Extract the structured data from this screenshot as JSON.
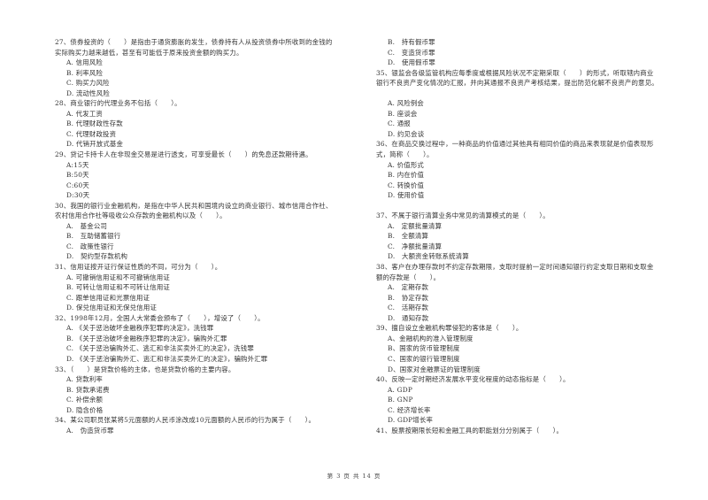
{
  "left_column": [
    {
      "type": "stem",
      "text": "27、债券投资的（　　）是指由于通货膨胀的发生，债券持有人从投资债券中所收到的金钱的"
    },
    {
      "type": "stem",
      "text": "实际购买力越来越低，甚至有可能低于原来投资金额的购买力。"
    },
    {
      "type": "opt",
      "text": "A. 信用风险"
    },
    {
      "type": "opt",
      "text": "B. 利率风险"
    },
    {
      "type": "opt",
      "text": "C. 购买力风险"
    },
    {
      "type": "opt",
      "text": "D. 流动性风险"
    },
    {
      "type": "stem",
      "text": "28、商业银行的代理业务不包括（　　）。"
    },
    {
      "type": "opt",
      "text": "A. 代发工资"
    },
    {
      "type": "opt",
      "text": "B. 代理财政性存款"
    },
    {
      "type": "opt",
      "text": "C. 代理财政投资"
    },
    {
      "type": "opt",
      "text": "D. 代销开放式基金"
    },
    {
      "type": "stem",
      "text": "29、贷记卡持卡人在非现金交易是进行透支，可享受最长（　　）的免息还款期待遇。"
    },
    {
      "type": "opt",
      "text": "A:15天"
    },
    {
      "type": "opt",
      "text": "B:50天"
    },
    {
      "type": "opt",
      "text": "C:60天"
    },
    {
      "type": "opt",
      "text": "D:30天"
    },
    {
      "type": "stem",
      "text": "30、我国的银行业金融机构，是指在中华人民共和国境内设立的商业银行、城市信用合作社、"
    },
    {
      "type": "stem",
      "text": "农村信用合作社等吸收公众存款的金融机构以及（　　）。"
    },
    {
      "type": "opt",
      "text": "A.　基金公司"
    },
    {
      "type": "opt",
      "text": "B.　互助储蓄银行"
    },
    {
      "type": "opt",
      "text": "C.　政策性银行"
    },
    {
      "type": "opt",
      "text": "D.　契约型存款机构"
    },
    {
      "type": "stem",
      "text": "31、信用证按开证行保证性质的不同，可分为（　　）。"
    },
    {
      "type": "opt",
      "text": "A. 可撤销信用证和不可撤销信用证"
    },
    {
      "type": "opt",
      "text": "B. 可转让信用证和不可转让信用证"
    },
    {
      "type": "opt",
      "text": "C. 跟单信用证和光票信用证"
    },
    {
      "type": "opt",
      "text": "D. 保兑信用证和无保兑信用证"
    },
    {
      "type": "stem",
      "text": "32、1998年12月，全国人大常委会颁布了（　　），增设了（　　）。"
    },
    {
      "type": "opt",
      "text": "A. 《关于惩治破坏金融秩序犯罪的决定》，洗钱罪"
    },
    {
      "type": "opt",
      "text": "B. 《关于惩治破坏金融秩序犯罪的决定》，骗购外汇罪"
    },
    {
      "type": "opt",
      "text": "C. 《关于惩治骗购外汇、逃汇和非法买卖外汇的决定》，洗钱罪"
    },
    {
      "type": "opt",
      "text": "D. 《关于惩治骗购外汇、逃汇和非法买卖外汇的决定》，骗购外汇罪"
    },
    {
      "type": "stem",
      "text": "33、（　　）是贷款价格的主体，也是贷款价格的主要内容。"
    },
    {
      "type": "opt",
      "text": "A. 贷款利率"
    },
    {
      "type": "opt",
      "text": "B. 贷款承诺费"
    },
    {
      "type": "opt",
      "text": "C. 补偿余额"
    },
    {
      "type": "opt",
      "text": "D. 隐含价格"
    },
    {
      "type": "stem",
      "text": "34、某公司职员张某将5元面额的人民币涂改成10元面额的人民币的行为属于（　　）。"
    },
    {
      "type": "opt",
      "text": "A.　伪造货币罪"
    }
  ],
  "right_column": [
    {
      "type": "opt",
      "text": "B.　持有假币罪"
    },
    {
      "type": "opt",
      "text": "C.　变造货币罪"
    },
    {
      "type": "opt",
      "text": "D.　使用假币罪"
    },
    {
      "type": "stem",
      "text": "35、银监会各级监管机构应每季度或根据风险状况不定期采取（　　）的形式，听取辖内商业"
    },
    {
      "type": "stem",
      "text": "银行不良资产变化情况的汇报，并向其通报不良资产考核结果，提出防范化解不良资产的意见。"
    },
    {
      "type": "blank",
      "text": ""
    },
    {
      "type": "opt",
      "text": "A. 风险例会"
    },
    {
      "type": "opt",
      "text": "B. 座谈会"
    },
    {
      "type": "opt",
      "text": "C. 通报"
    },
    {
      "type": "opt",
      "text": "D. 约见会谈"
    },
    {
      "type": "stem",
      "text": "36、在商品交换过程中，一种商品的价值通过其他具有相同价值的商品来表现就是价值表现形"
    },
    {
      "type": "stem",
      "text": "式，简称（　　）。"
    },
    {
      "type": "opt",
      "text": "A. 价值形式"
    },
    {
      "type": "opt",
      "text": "B. 内在价值"
    },
    {
      "type": "opt",
      "text": "C. 转换价值"
    },
    {
      "type": "opt",
      "text": "D. 使用价值"
    },
    {
      "type": "blank",
      "text": ""
    },
    {
      "type": "stem",
      "text": "37、不属于银行清算业务中常见的清算模式的是（　　）。"
    },
    {
      "type": "opt",
      "text": "A.　定额批量清算"
    },
    {
      "type": "opt",
      "text": "B.　全额清算"
    },
    {
      "type": "opt",
      "text": "C.　净额批量清算"
    },
    {
      "type": "opt",
      "text": "D.　大额资金转账系统清算"
    },
    {
      "type": "stem",
      "text": "38、客户在办理存款时不约定存款期限，支取时提前一定时间通知银行约定支取日期和支取金"
    },
    {
      "type": "stem",
      "text": "额的存款是（　　）。"
    },
    {
      "type": "opt",
      "text": "A.　定期存款"
    },
    {
      "type": "opt",
      "text": "B.　协定存款"
    },
    {
      "type": "opt",
      "text": "C.　活期存款"
    },
    {
      "type": "opt",
      "text": "D.　通知存款"
    },
    {
      "type": "stem",
      "text": "39、擅自设立金融机构罪侵犯的客体是（　　）。"
    },
    {
      "type": "opt",
      "text": "A、金融机构的准入管理制度"
    },
    {
      "type": "opt",
      "text": "B、国家的货币管理制度"
    },
    {
      "type": "opt",
      "text": "C、国家的银行管理制度"
    },
    {
      "type": "opt",
      "text": "D、国家对金融票证的管理制度"
    },
    {
      "type": "stem",
      "text": "40、反映一定时期经济发展水平变化程度的动态指标是（　　）。"
    },
    {
      "type": "opt",
      "text": "A. GDP"
    },
    {
      "type": "opt",
      "text": "B. GNP"
    },
    {
      "type": "opt",
      "text": "C. 经济增长率"
    },
    {
      "type": "opt",
      "text": "D. GDP增长率"
    },
    {
      "type": "stem",
      "text": "41、股票按期限长短和金融工具的职能划分分别属于（　　）。"
    }
  ],
  "footer": {
    "page_label": "第 3 页 共 14 页"
  }
}
